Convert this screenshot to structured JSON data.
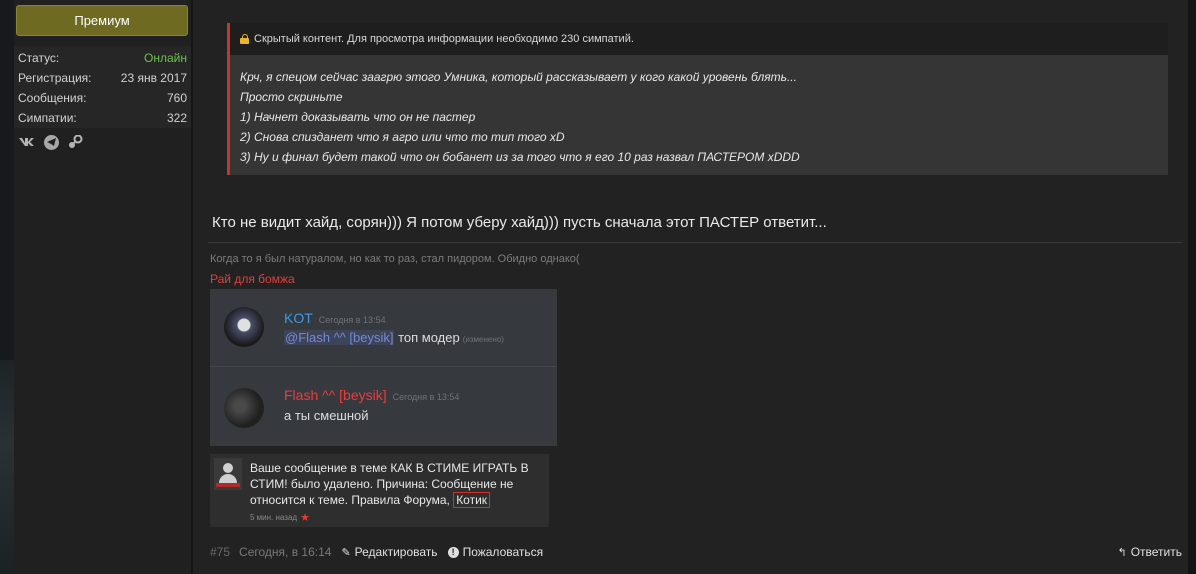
{
  "user_panel": {
    "premium_label": "Премиум",
    "stats": [
      {
        "label": "Статус:",
        "value": "Онлайн"
      },
      {
        "label": "Регистрация:",
        "value": "23 янв 2017"
      },
      {
        "label": "Сообщения:",
        "value": "760"
      },
      {
        "label": "Симпатии:",
        "value": "322"
      }
    ],
    "status_color": "#6cc04a",
    "social_icons": [
      "vk-icon",
      "telegram-icon",
      "steam-icon"
    ]
  },
  "post": {
    "hidden_notice": "Скрытый контент. Для просмотра информации необходимо 230 симпатий.",
    "hidden_lines": [
      "Крч, я спецом сейчас заагрю этого Умника, который рассказывает у кого какой уровень блять...",
      "Просто скриньте",
      "1) Начнет доказывать что он не пастер",
      "2) Снова спизданет что я агро или что то тип того xD",
      "3) Ну и финал будет такой что он бобанет из за того что я его 10 раз назвал ПАСТЕРОМ xDDD"
    ],
    "main_text": "Кто не видит хайд, сорян))) Я потом уберу хайд))) пусть сначала этот ПАСТЕР ответит...",
    "signature_line1": "Когда то я был натуралом, но как то раз, стал пидором. Обидно однако(",
    "signature_line2": "Рай для бомжа"
  },
  "discord": {
    "messages": [
      {
        "author": "KOT",
        "time": "Сегодня в 13:54",
        "mention": "@Flash ^^ [beysik]",
        "text": " топ модер",
        "edited": "(изменено)"
      },
      {
        "author": "Flash ^^ [beysik]",
        "time": "Сегодня в 13:54",
        "text": "а ты смешной"
      }
    ]
  },
  "notification": {
    "text": "Ваше сообщение в теме КАК В СТИМЕ ИГРАТЬ В СТИМ! было удалено. Причина: Сообщение не относится к теме. Правила Форума,",
    "highlight": "Котик",
    "time": "5 мин. назад"
  },
  "footer": {
    "post_number": "#75",
    "timestamp": "Сегодня, в 16:14",
    "edit_label": "Редактировать",
    "report_label": "Пожаловаться",
    "reply_label": "Ответить"
  },
  "colors": {
    "premium": "#6f6a21",
    "hidden_border": "#c0392b",
    "lock": "#e8b62e",
    "signature_red": "#e0413b",
    "discord_bg": "#36393e",
    "kot_name": "#3e9ae2",
    "flash_name": "#ec3c3c"
  }
}
